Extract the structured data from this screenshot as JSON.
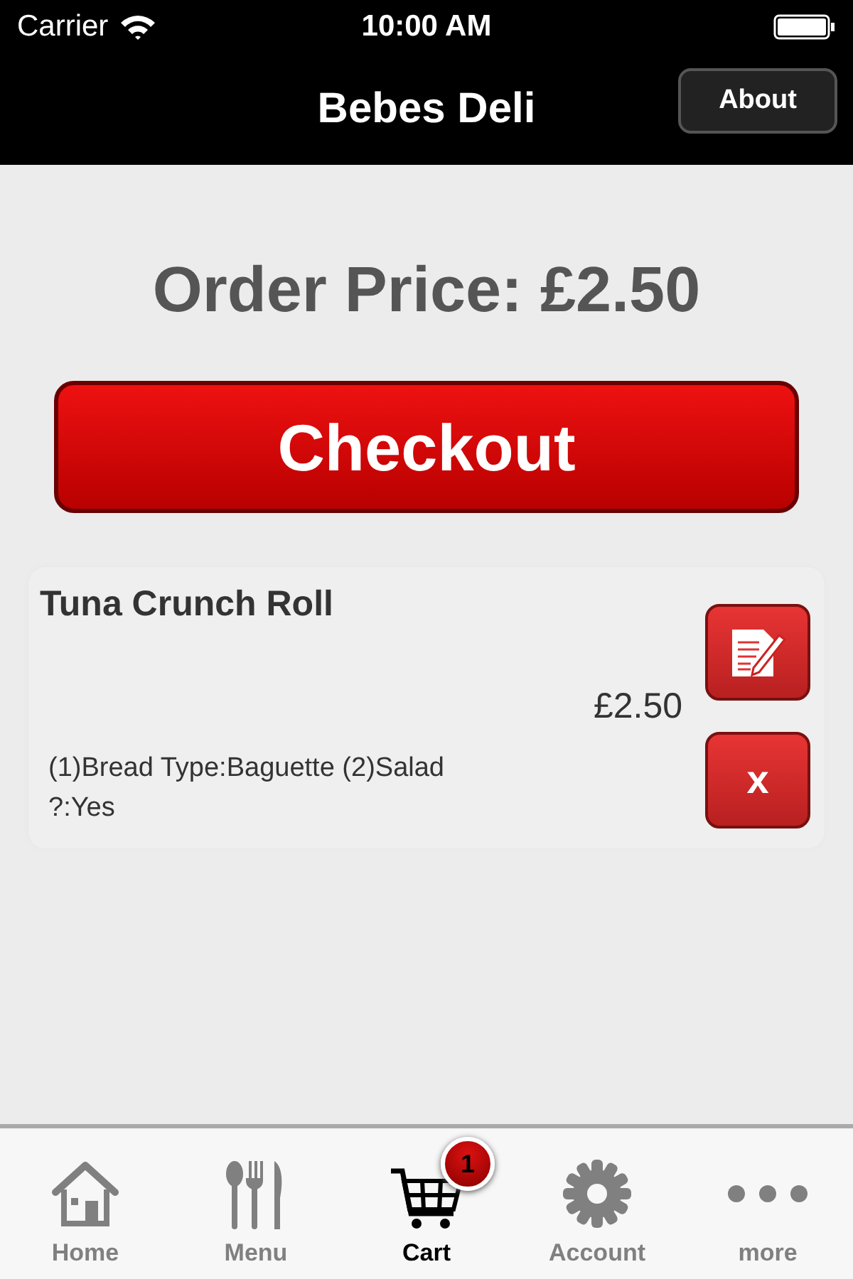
{
  "status_bar": {
    "carrier": "Carrier",
    "time": "10:00 AM"
  },
  "nav_bar": {
    "title": "Bebes Deli",
    "button": "About"
  },
  "order_price": "Order Price: £2.50",
  "checkout_button": "Checkout",
  "cart_items": [
    {
      "name": "Tuna Crunch Roll",
      "price": "£2.50",
      "options": "(1)Bread Type:Baguette (2)Salad ?:Yes",
      "remove_label": "x"
    }
  ],
  "tabs": [
    {
      "label": "Home",
      "kind": "home",
      "selected": false
    },
    {
      "label": "Menu",
      "kind": "menu",
      "selected": false
    },
    {
      "label": "Cart",
      "kind": "cart",
      "selected": true,
      "badge": "1"
    },
    {
      "label": "Account",
      "kind": "account",
      "selected": false
    },
    {
      "label": "more",
      "kind": "more",
      "selected": false
    }
  ]
}
